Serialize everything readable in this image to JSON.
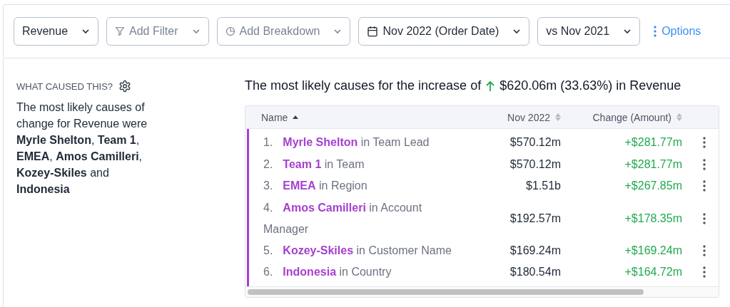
{
  "toolbar": {
    "dropdowns": [
      {
        "label": "Revenue",
        "muted": false
      },
      {
        "label": "Add Filter",
        "muted": true
      },
      {
        "label": "Add Breakdown",
        "muted": true
      },
      {
        "label": "Nov 2022 (Order Date)",
        "muted": false
      },
      {
        "label": "vs Nov 2021",
        "muted": false
      }
    ],
    "options_link": "Options"
  },
  "sidebar": {
    "heading": "WHAT CAUSED THIS?",
    "summary": "The most likely causes of change for Revenue were **Myrle Shelton**, **Team 1**, **EMEA**, **Amos Camilleri**, **Kozey-Skiles** and **Indonesia**"
  },
  "result": {
    "heading_start": "The most likely causes for the increase of",
    "increase": true,
    "heading_end": "$620.06m (33.63%) in Revenue"
  },
  "table": {
    "columns": [
      {
        "label": "Name",
        "sorted": true
      },
      {
        "label": "Nov 2022",
        "sorted": false
      },
      {
        "label": "Change (Amount)",
        "sorted": false
      }
    ],
    "rows": [
      {
        "rank": "1.",
        "name": "Myrle Shelton",
        "dimension": "in Team Lead",
        "value": "$570.12m",
        "change": "+$281.77m"
      },
      {
        "rank": "2.",
        "name": "Team 1",
        "dimension": "in Team",
        "value": "$570.12m",
        "change": "+$281.77m"
      },
      {
        "rank": "3.",
        "name": "EMEA",
        "dimension": "in Region",
        "value": "$1.51b",
        "change": "+$267.85m"
      },
      {
        "rank": "4.",
        "name": "Amos Camilleri",
        "dimension": "in Account Manager",
        "value": "$192.57m",
        "change": "+$178.35m"
      },
      {
        "rank": "5.",
        "name": "Kozey-Skiles",
        "dimension": "in Customer Name",
        "value": "$169.24m",
        "change": "+$169.24m"
      },
      {
        "rank": "6.",
        "name": "Indonesia",
        "dimension": "in Country",
        "value": "$180.54m",
        "change": "+$164.72m"
      }
    ]
  }
}
